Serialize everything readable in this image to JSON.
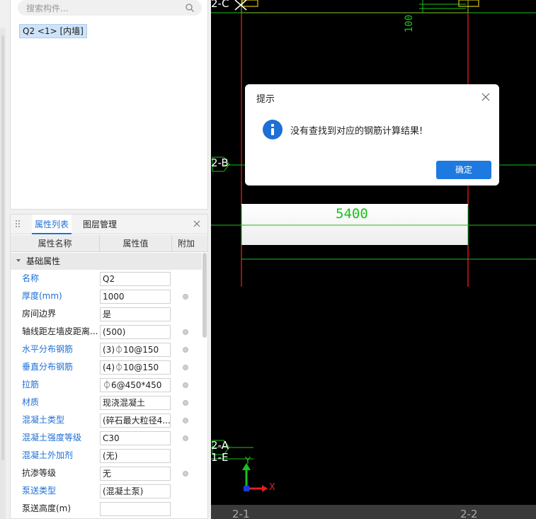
{
  "tree": {
    "search_placeholder": "搜索构件...",
    "selected_item": "Q2 <1> [内墙]"
  },
  "props": {
    "tabs": [
      "属性列表",
      "图层管理"
    ],
    "columns": [
      "属性名称",
      "属性值",
      "附加"
    ],
    "group": "基础属性",
    "rows": [
      {
        "name": "名称",
        "value": "Q2"
      },
      {
        "name": "厚度(mm)",
        "value": "1000"
      },
      {
        "name": "房间边界",
        "value": "是"
      },
      {
        "name": "轴线距左墙皮距离...",
        "value": "(500)"
      },
      {
        "name": "水平分布钢筋",
        "value": "(3)⏀10@150"
      },
      {
        "name": "垂直分布钢筋",
        "value": "(4)⏀10@150"
      },
      {
        "name": "拉筋",
        "value": "⏀6@450*450"
      },
      {
        "name": "材质",
        "value": "现浇混凝土"
      },
      {
        "name": "混凝土类型",
        "value": "(碎石最大粒径4..."
      },
      {
        "name": "混凝土强度等级",
        "value": "C30"
      },
      {
        "name": "混凝土外加剂",
        "value": "(无)"
      },
      {
        "name": "抗渗等级",
        "value": "无"
      },
      {
        "name": "泵送类型",
        "value": "(混凝土泵)"
      },
      {
        "name": "泵送高度(m)",
        "value": ""
      }
    ]
  },
  "cad": {
    "axis_2C": "2-C",
    "axis_2B": "2-B",
    "axis_2A": "2-A",
    "axis_1E": "1-E",
    "axis_21": "2-1",
    "axis_22": "2-2",
    "dimension": "5400",
    "vertical_dim": "100",
    "ucs_y": "Y",
    "ucs_x": "X"
  },
  "dialog": {
    "title": "提示",
    "message": "没有查找到对应的钢筋计算结果!",
    "ok_label": "确定"
  },
  "colors": {
    "accent": "#1e6fd6",
    "cad_green": "#19c219",
    "cad_red": "#d01818",
    "cad_yellow": "#d6c218"
  }
}
